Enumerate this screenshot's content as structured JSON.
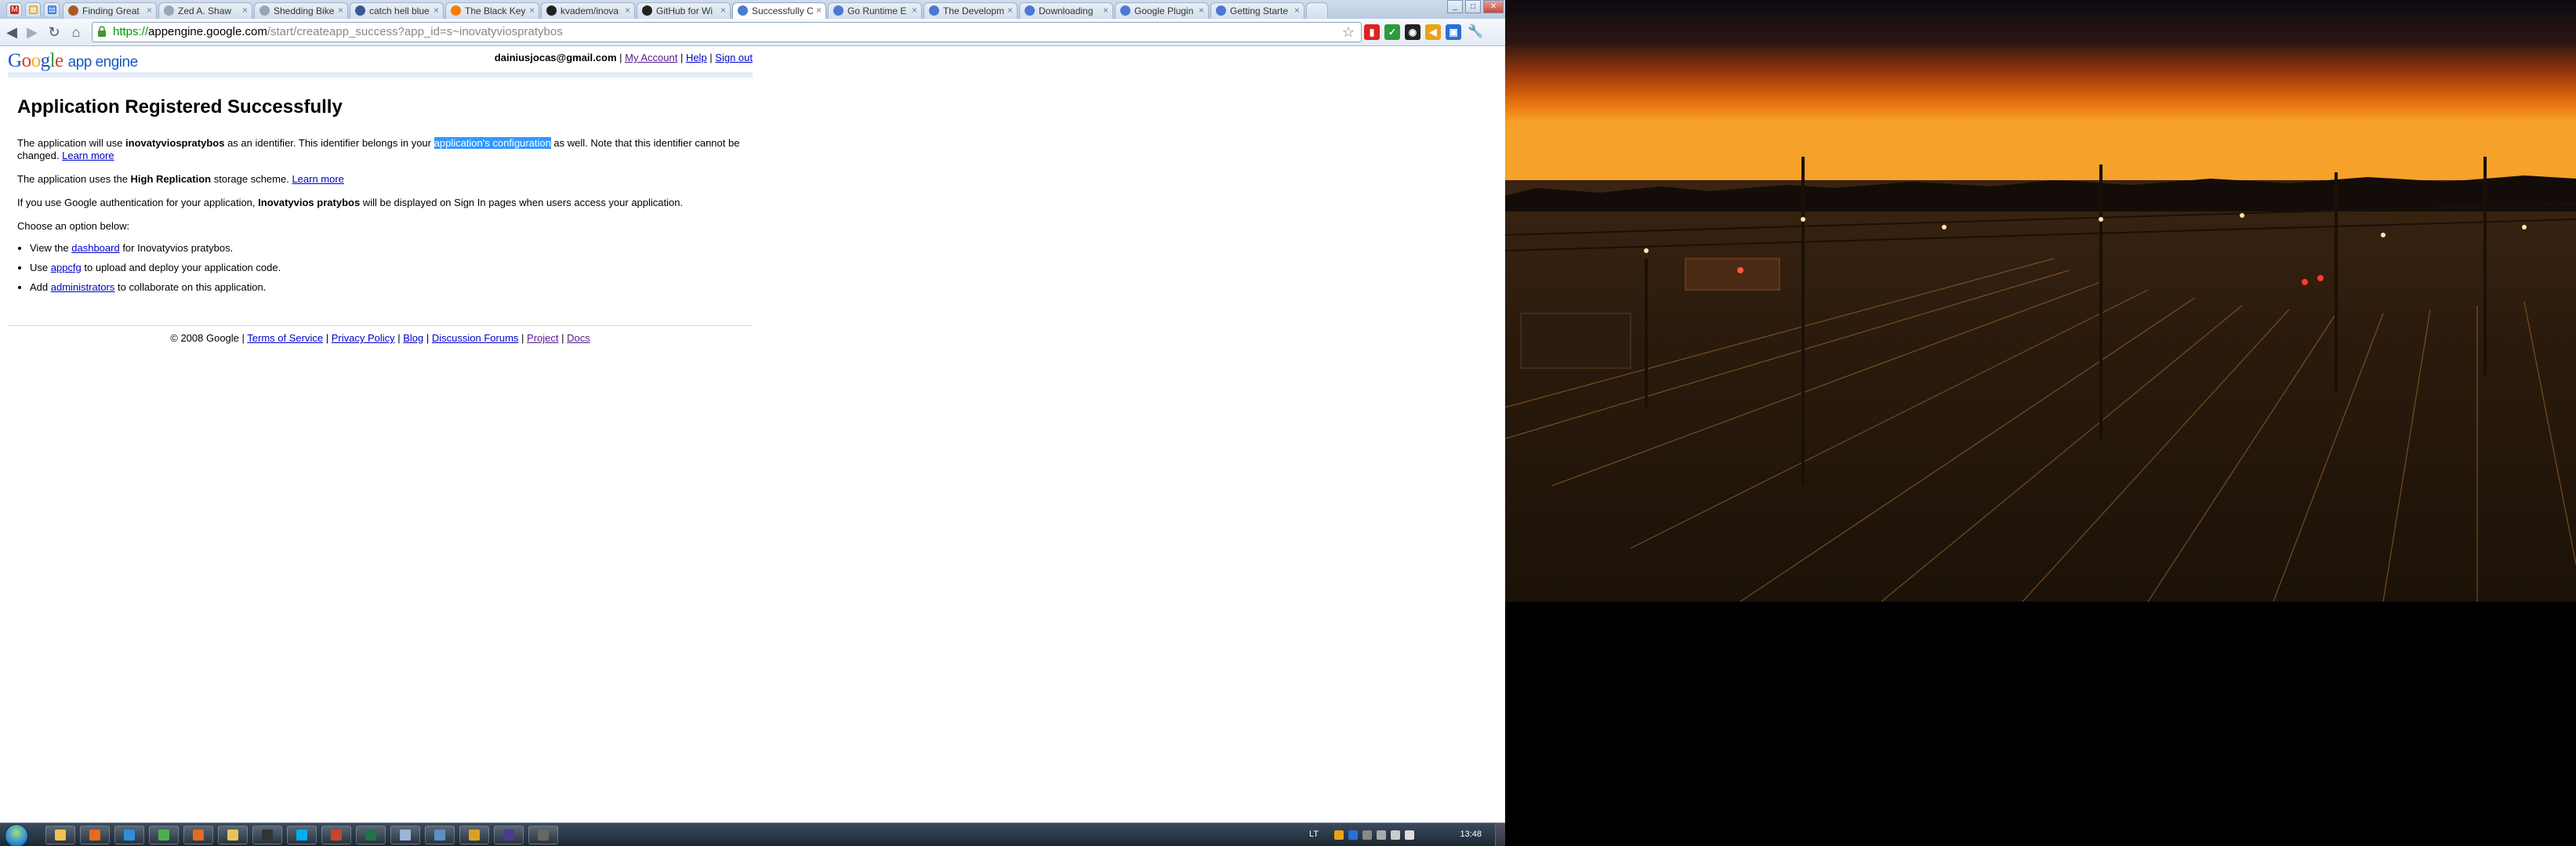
{
  "browser": {
    "pinned_tabs": [
      {
        "icon": "gmail-icon",
        "color": "#c5281c"
      },
      {
        "icon": "calendar-icon",
        "color": "#e8a317"
      },
      {
        "icon": "docs-icon",
        "color": "#2a6fd6"
      }
    ],
    "tabs": [
      {
        "title": "Finding Great",
        "icon": "page-icon",
        "color": "#a85a2a",
        "active": false
      },
      {
        "title": "Zed A. Shaw",
        "icon": "globe-icon",
        "color": "#9aa6b2",
        "active": false
      },
      {
        "title": "Shedding Bike",
        "icon": "globe-icon",
        "color": "#9aa6b2",
        "active": false
      },
      {
        "title": "catch hell blue",
        "icon": "page-icon",
        "color": "#3b5998",
        "active": false
      },
      {
        "title": "The Black Key",
        "icon": "blogger-icon",
        "color": "#f57d00",
        "active": false
      },
      {
        "title": "kvadem/inova",
        "icon": "github-icon",
        "color": "#222222",
        "active": false
      },
      {
        "title": "GitHub for Wi",
        "icon": "github-icon",
        "color": "#222222",
        "active": false
      },
      {
        "title": "Successfully C",
        "icon": "appengine-icon",
        "color": "#4a7bd0",
        "active": true
      },
      {
        "title": "Go Runtime E",
        "icon": "appengine-icon",
        "color": "#4a7bd0",
        "active": false
      },
      {
        "title": "The Developm",
        "icon": "appengine-icon",
        "color": "#4a7bd0",
        "active": false
      },
      {
        "title": "Downloading",
        "icon": "appengine-icon",
        "color": "#4a7bd0",
        "active": false
      },
      {
        "title": "Google Plugin",
        "icon": "appengine-icon",
        "color": "#4a7bd0",
        "active": false
      },
      {
        "title": "Getting Starte",
        "icon": "appengine-icon",
        "color": "#4a7bd0",
        "active": false
      }
    ],
    "url_scheme": "https://",
    "url_host": "appengine.google.com",
    "url_path": "/start/createapp_success?app_id=s~inovatyviospratybos"
  },
  "header": {
    "logo": {
      "G": "G",
      "o1": "o",
      "o2": "o",
      "g": "g",
      "l": "l",
      "e": "e",
      "product": "app engine"
    },
    "user_email": "dainiusjocas@gmail.com",
    "sep1": " | ",
    "my_account": "My Account",
    "sep2": " | ",
    "help": "Help",
    "sep3": " | ",
    "sign_out": "Sign out"
  },
  "main": {
    "title": "Application Registered Successfully",
    "p1_a": "The application will use ",
    "p1_app_id": "inovatyviospratybos",
    "p1_b": " as an identifier. This identifier belongs in your ",
    "p1_link": "application's configuration",
    "p1_c": " as well. Note that this identifier cannot be changed. ",
    "p1_learn_more": "Learn more",
    "p2_a": "The application uses the ",
    "p2_scheme": "High Replication",
    "p2_b": " storage scheme. ",
    "p2_learn_more": "Learn more",
    "p3_a": "If you use Google authentication for your application, ",
    "p3_name": "Inovatyvios pratybos",
    "p3_b": " will be displayed on Sign In pages when users access your application.",
    "p4": "Choose an option below:",
    "options": [
      {
        "pre": "View the ",
        "link": "dashboard",
        "post": " for Inovatyvios pratybos."
      },
      {
        "pre": "Use ",
        "link": "appcfg",
        "post": " to upload and deploy your application code."
      },
      {
        "pre": "Add ",
        "link": "administrators",
        "post": " to collaborate on this application."
      }
    ]
  },
  "footer": {
    "copyright": "© 2008 Google",
    "sep": " | ",
    "links": [
      "Terms of Service",
      "Privacy Policy",
      "Blog",
      "Discussion Forums",
      "Project",
      "Docs"
    ]
  },
  "taskbar": {
    "apps": [
      {
        "icon": "folder-icon",
        "color": "#f2c14e"
      },
      {
        "icon": "firefox-icon",
        "color": "#e66a1f"
      },
      {
        "icon": "ie-icon",
        "color": "#2a8fd8"
      },
      {
        "icon": "chrome-icon",
        "color": "#4caf50"
      },
      {
        "icon": "firefox-icon",
        "color": "#e66a1f"
      },
      {
        "icon": "explorer-icon",
        "color": "#e8c35a"
      },
      {
        "icon": "terminal-icon",
        "color": "#333333"
      },
      {
        "icon": "skype-icon",
        "color": "#00aff0"
      },
      {
        "icon": "presentation-icon",
        "color": "#c6452b"
      },
      {
        "icon": "spreadsheet-icon",
        "color": "#207245"
      },
      {
        "icon": "notepad-icon",
        "color": "#9bb5d6"
      },
      {
        "icon": "network-icon",
        "color": "#5d8fc5"
      },
      {
        "icon": "media-icon",
        "color": "#d9a321"
      },
      {
        "icon": "eclipse-icon",
        "color": "#4b3b8f"
      },
      {
        "icon": "console-icon",
        "color": "#666666"
      }
    ],
    "language": "LT",
    "clock": "13:48"
  }
}
